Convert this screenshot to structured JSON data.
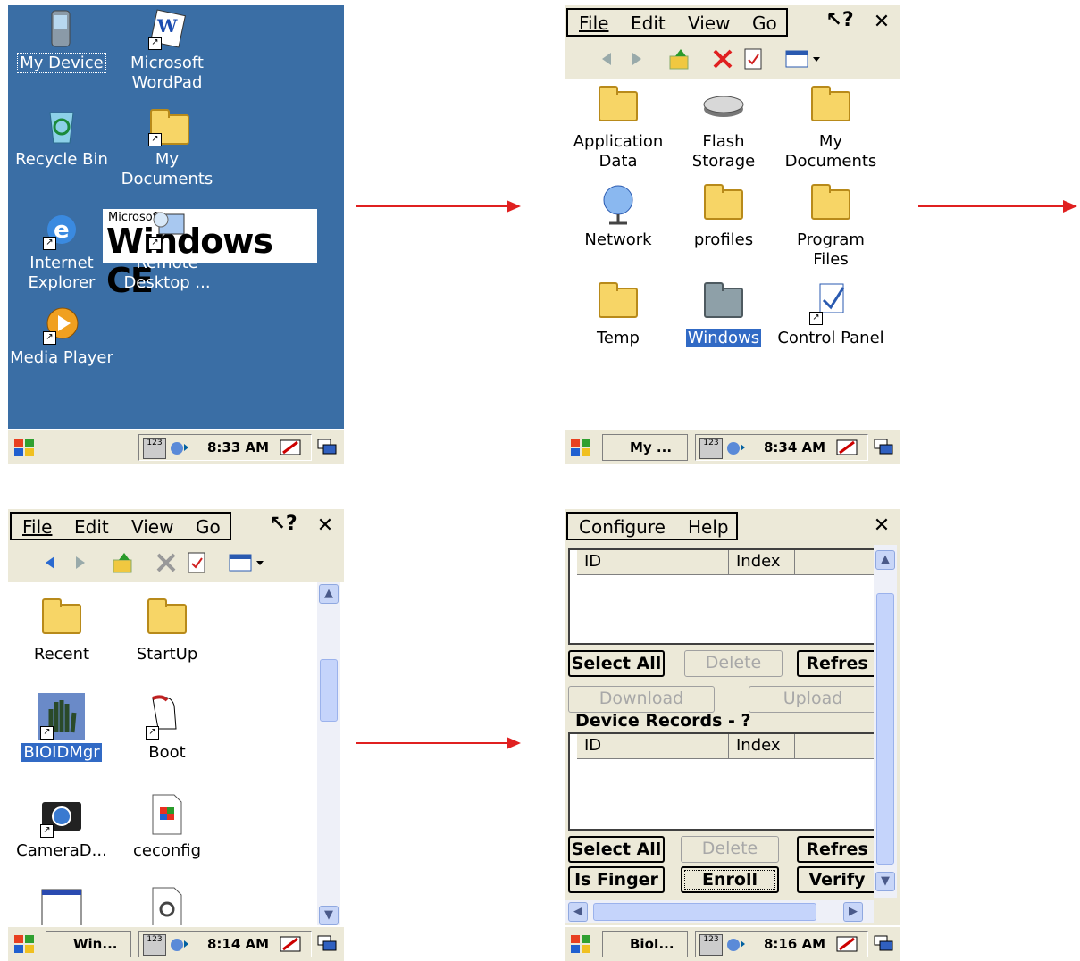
{
  "panel1": {
    "icons": [
      {
        "label": "My Device",
        "icon": "my-device-icon"
      },
      {
        "label": "Microsoft WordPad",
        "icon": "wordpad-icon"
      },
      {
        "label": "Recycle Bin",
        "icon": "recycle-bin-icon"
      },
      {
        "label": "My Documents",
        "icon": "folder-icon"
      },
      {
        "label": "Internet Explorer",
        "icon": "internet-explorer-icon"
      },
      {
        "label": "Remote Desktop ...",
        "icon": "remote-desktop-icon"
      },
      {
        "label": "Media Player",
        "icon": "media-player-icon"
      }
    ],
    "logo_small": "Microsoft",
    "logo_big": "Windows CE",
    "clock": "8:33 AM"
  },
  "panel2": {
    "menu": [
      "File",
      "Edit",
      "View",
      "Go"
    ],
    "icons": [
      {
        "label": "Application Data",
        "icon": "folder-icon"
      },
      {
        "label": "Flash Storage",
        "icon": "flash-storage-icon"
      },
      {
        "label": "My Documents",
        "icon": "folder-icon"
      },
      {
        "label": "Network",
        "icon": "network-icon"
      },
      {
        "label": "profiles",
        "icon": "folder-icon"
      },
      {
        "label": "Program Files",
        "icon": "folder-icon"
      },
      {
        "label": "Temp",
        "icon": "folder-icon"
      },
      {
        "label": "Windows",
        "icon": "folder-icon"
      },
      {
        "label": "Control Panel",
        "icon": "control-panel-icon"
      }
    ],
    "taskbar_button": "My ...",
    "clock": "8:34 AM"
  },
  "panel3": {
    "menu": [
      "File",
      "Edit",
      "View",
      "Go"
    ],
    "icons": [
      {
        "label": "Recent",
        "icon": "folder-icon"
      },
      {
        "label": "StartUp",
        "icon": "folder-icon"
      },
      {
        "label": "BIOIDMgr",
        "icon": "bioidmgr-icon"
      },
      {
        "label": "Boot",
        "icon": "boot-icon"
      },
      {
        "label": "CameraD...",
        "icon": "camera-icon"
      },
      {
        "label": "ceconfig",
        "icon": "ceconfig-icon"
      }
    ],
    "taskbar_button": "Win...",
    "clock": "8:14 AM"
  },
  "panel4": {
    "menu": [
      "Configure",
      "Help"
    ],
    "list1_headers": [
      "ID",
      "Index"
    ],
    "row1_buttons": [
      "Select All",
      "Delete",
      "Refres"
    ],
    "row2_buttons": [
      "Download",
      "Upload"
    ],
    "device_records_label": "Device Records - ?",
    "list2_headers": [
      "ID",
      "Index"
    ],
    "row3_buttons": [
      "Select All",
      "Delete",
      "Refres"
    ],
    "row4_buttons": [
      "Is Finger",
      "Enroll",
      "Verify"
    ],
    "taskbar_button": "BioI...",
    "clock": "8:16 AM"
  },
  "colors": {
    "desktop_blue": "#3a6ea5",
    "chrome": "#ece9d8",
    "selection": "#316ac5",
    "arrow": "#e02020"
  }
}
